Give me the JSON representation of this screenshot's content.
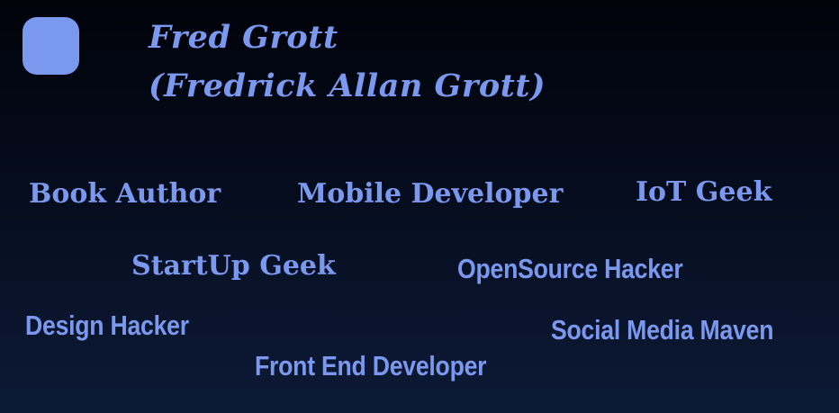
{
  "profile": {
    "name": "Fred Grott",
    "full_name": "(Fredrick Allan Grott)"
  },
  "tags": {
    "book_author": "Book Author",
    "mobile_developer": "Mobile Developer",
    "iot_geek": "IoT Geek",
    "startup_geek": "StartUp Geek",
    "opensource_hacker": "OpenSource Hacker",
    "design_hacker": "Design Hacker",
    "social_media_maven": "Social Media Maven",
    "front_end_developer": "Front End Developer"
  },
  "colors": {
    "accent": "#7b98ef",
    "background_top": "#01030a",
    "background_bottom": "#0d1a36"
  }
}
